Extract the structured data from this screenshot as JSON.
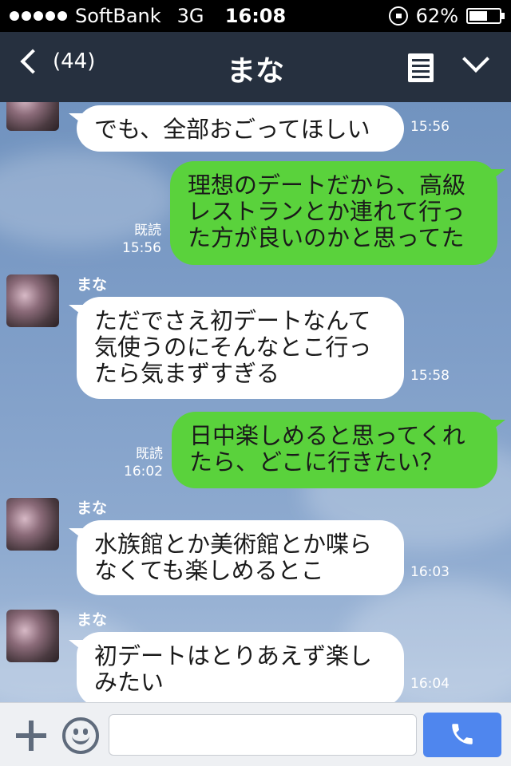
{
  "status_bar": {
    "carrier": "SoftBank",
    "network": "3G",
    "time": "16:08",
    "battery": "62%",
    "battery_level": 0.62
  },
  "nav": {
    "back_count": "(44)",
    "title": "まな"
  },
  "messages": [
    {
      "dir": "in",
      "sender": "",
      "text": "でも、全部おごってほしい",
      "time": "15:56",
      "read": ""
    },
    {
      "dir": "out",
      "sender": "",
      "text": "理想のデートだから、高級\nレストランとか連れて行っ\nた方が良いのかと思ってた",
      "time": "15:56",
      "read": "既読"
    },
    {
      "dir": "in",
      "sender": "まな",
      "text": "ただでさえ初デートなんて\n気使うのにそんなとこ行っ\nたら気まずすぎる",
      "time": "15:58",
      "read": ""
    },
    {
      "dir": "out",
      "sender": "",
      "text": "日中楽しめると思ってくれ\nたら、どこに行きたい？",
      "time": "16:02",
      "read": "既読"
    },
    {
      "dir": "in",
      "sender": "まな",
      "text": "水族館とか美術館とか喋ら\nなくても楽しめるとこ",
      "time": "16:03",
      "read": ""
    },
    {
      "dir": "in",
      "sender": "まな",
      "text": "初デートはとりあえず楽し\nみたい",
      "time": "16:04",
      "read": ""
    }
  ],
  "input": {
    "value": "",
    "placeholder": ""
  },
  "icons": {
    "plus": "plus-icon",
    "smiley": "smiley-icon",
    "phone": "phone-icon",
    "menu": "menu-icon"
  },
  "colors": {
    "nav": "#26303f",
    "outgoing_bubble": "#5ad23c",
    "incoming_bubble": "#ffffff",
    "call_button": "#4f86ee"
  }
}
